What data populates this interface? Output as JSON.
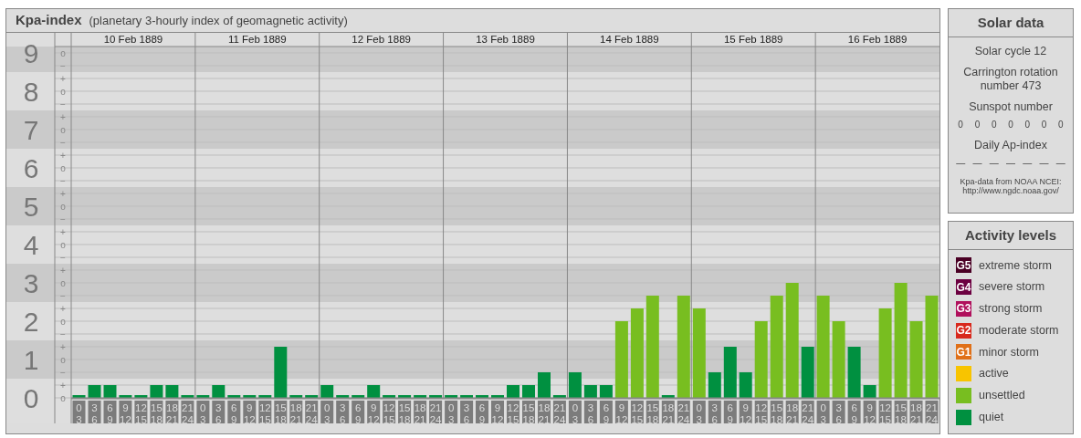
{
  "header": {
    "title": "Kpa-index",
    "subtitle": "(planetary 3-hourly index of geomagnetic activity)"
  },
  "chart": {
    "days": [
      "10 Feb 1889",
      "11 Feb 1889",
      "12 Feb 1889",
      "13 Feb 1889",
      "14 Feb 1889",
      "15 Feb 1889",
      "16 Feb 1889"
    ],
    "minor_ticks": [
      "o",
      "−",
      "+",
      "o",
      "−",
      "+",
      "o",
      "−",
      "+",
      "o",
      "−",
      "+",
      "o",
      "−",
      "+",
      "o",
      "−",
      "+",
      "o",
      "−",
      "+",
      "o",
      "−",
      "+",
      "o",
      "−",
      "+",
      "o"
    ],
    "chart_data": {
      "type": "bar",
      "grid": true,
      "ylim": [
        0,
        9
      ],
      "yticks": [
        0,
        1,
        2,
        3,
        4,
        5,
        6,
        7,
        8,
        9
      ],
      "categories": [
        "0 3",
        "3 6",
        "6 9",
        "9 12",
        "12 15",
        "15 18",
        "18 21",
        "21 24",
        "0 3",
        "3 6",
        "6 9",
        "9 12",
        "12 15",
        "15 18",
        "18 21",
        "21 24",
        "0 3",
        "3 6",
        "6 9",
        "9 12",
        "12 15",
        "15 18",
        "18 21",
        "21 24",
        "0 3",
        "3 6",
        "6 9",
        "9 12",
        "12 15",
        "15 18",
        "18 21",
        "21 24",
        "0 3",
        "3 6",
        "6 9",
        "9 12",
        "12 15",
        "15 18",
        "18 21",
        "21 24",
        "0 3",
        "3 6",
        "6 9",
        "9 12",
        "12 15",
        "15 18",
        "18 21",
        "21 24",
        "0 3",
        "3 6",
        "6 9",
        "9 12",
        "12 15",
        "15 18",
        "18 21",
        "21 24"
      ],
      "series": [
        {
          "name": "quiet",
          "color": "#009040",
          "values": [
            0,
            0.33,
            0.33,
            0,
            0,
            0.33,
            0.33,
            0,
            0,
            0.33,
            0,
            0,
            0,
            1.33,
            0,
            0,
            0.33,
            0,
            0,
            0.33,
            0,
            0,
            0,
            0,
            0,
            0,
            0,
            0,
            0.33,
            0.33,
            0.67,
            0,
            0.67,
            0.33,
            0.33,
            null,
            null,
            null,
            0,
            null,
            null,
            0.67,
            1.33,
            0.67,
            null,
            null,
            null,
            1.33,
            null,
            null,
            1.33,
            0.33,
            null,
            null,
            null,
            null
          ]
        },
        {
          "name": "unsettled",
          "color": "#78be20",
          "values": [
            null,
            null,
            null,
            null,
            null,
            null,
            null,
            null,
            null,
            null,
            null,
            null,
            null,
            null,
            null,
            null,
            null,
            null,
            null,
            null,
            null,
            null,
            null,
            null,
            null,
            null,
            null,
            null,
            null,
            null,
            null,
            null,
            null,
            null,
            null,
            2,
            2.33,
            2.67,
            null,
            2.67,
            2.33,
            null,
            null,
            null,
            2,
            2.67,
            3,
            null,
            2.67,
            2,
            null,
            null,
            2.33,
            3,
            2,
            2.67
          ]
        }
      ]
    }
  },
  "solar_data": {
    "title": "Solar data",
    "solar_cycle": "Solar cycle 12",
    "carrington": "Carrington rotation number 473",
    "sunspot_label": "Sunspot number",
    "sunspot_values": [
      "0",
      "0",
      "0",
      "0",
      "0",
      "0",
      "0"
    ],
    "ap_label": "Daily Ap-index",
    "ap_values": [
      "—",
      "—",
      "—",
      "—",
      "—",
      "—",
      "—"
    ],
    "source": "Kpa-data from NOAA NCEI:",
    "source_url": "http://www.ngdc.noaa.gov/"
  },
  "activity_levels": {
    "title": "Activity levels",
    "items": [
      {
        "badge": "G5",
        "label": "extreme storm",
        "color": "#4a0024"
      },
      {
        "badge": "G4",
        "label": "severe storm",
        "color": "#6c0040"
      },
      {
        "badge": "G3",
        "label": "strong storm",
        "color": "#b0105c"
      },
      {
        "badge": "G2",
        "label": "moderate storm",
        "color": "#d8281c"
      },
      {
        "badge": "G1",
        "label": "minor storm",
        "color": "#e07018"
      },
      {
        "label": "active",
        "color": "#f8c400"
      },
      {
        "kind": "series"
      },
      {
        "kind": "series"
      }
    ]
  }
}
